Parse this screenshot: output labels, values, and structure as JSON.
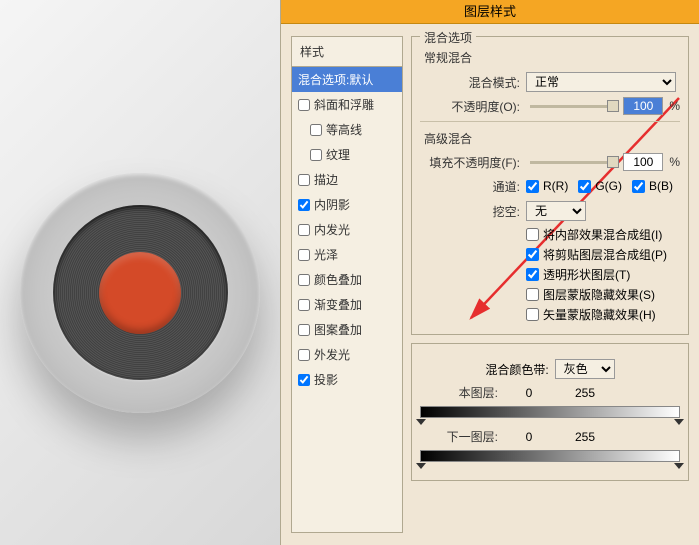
{
  "dialog": {
    "title": "图层样式",
    "styles_header": "样式",
    "styles": [
      {
        "id": "blend-default",
        "label": "混合选项:默认",
        "selected": true,
        "checkbox": false
      },
      {
        "id": "bevel",
        "label": "斜面和浮雕",
        "checkbox": true,
        "checked": false
      },
      {
        "id": "contour",
        "label": "等高线",
        "checkbox": true,
        "checked": false,
        "sub": true
      },
      {
        "id": "texture",
        "label": "纹理",
        "checkbox": true,
        "checked": false,
        "sub": true
      },
      {
        "id": "stroke",
        "label": "描边",
        "checkbox": true,
        "checked": false
      },
      {
        "id": "inner-shadow",
        "label": "内阴影",
        "checkbox": true,
        "checked": true
      },
      {
        "id": "inner-glow",
        "label": "内发光",
        "checkbox": true,
        "checked": false
      },
      {
        "id": "satin",
        "label": "光泽",
        "checkbox": true,
        "checked": false
      },
      {
        "id": "color-overlay",
        "label": "颜色叠加",
        "checkbox": true,
        "checked": false
      },
      {
        "id": "gradient-overlay",
        "label": "渐变叠加",
        "checkbox": true,
        "checked": false
      },
      {
        "id": "pattern-overlay",
        "label": "图案叠加",
        "checkbox": true,
        "checked": false
      },
      {
        "id": "outer-glow",
        "label": "外发光",
        "checkbox": true,
        "checked": false
      },
      {
        "id": "drop-shadow",
        "label": "投影",
        "checkbox": true,
        "checked": true
      }
    ],
    "blend_options": {
      "group_title": "混合选项",
      "general": {
        "title": "常规混合",
        "mode_label": "混合模式:",
        "mode_value": "正常",
        "opacity_label": "不透明度(O):",
        "opacity_value": "100",
        "opacity_unit": "%"
      },
      "advanced": {
        "title": "高级混合",
        "fill_label": "填充不透明度(F):",
        "fill_value": "100",
        "fill_unit": "%",
        "channel_label": "通道:",
        "channels": [
          {
            "name": "R(R)",
            "checked": true
          },
          {
            "name": "G(G)",
            "checked": true
          },
          {
            "name": "B(B)",
            "checked": true
          }
        ],
        "knockout_label": "挖空:",
        "knockout_value": "无",
        "extra": [
          {
            "label": "将内部效果混合成组(I)",
            "checked": false
          },
          {
            "label": "将剪贴图层混合成组(P)",
            "checked": true
          },
          {
            "label": "透明形状图层(T)",
            "checked": true
          },
          {
            "label": "图层蒙版隐藏效果(S)",
            "checked": false
          },
          {
            "label": "矢量蒙版隐藏效果(H)",
            "checked": false
          }
        ]
      },
      "blend_if": {
        "label": "混合颜色带:",
        "value": "灰色",
        "this_layer_label": "本图层:",
        "this_low": "0",
        "this_high": "255",
        "under_layer_label": "下一图层:",
        "under_low": "0",
        "under_high": "255"
      }
    }
  }
}
